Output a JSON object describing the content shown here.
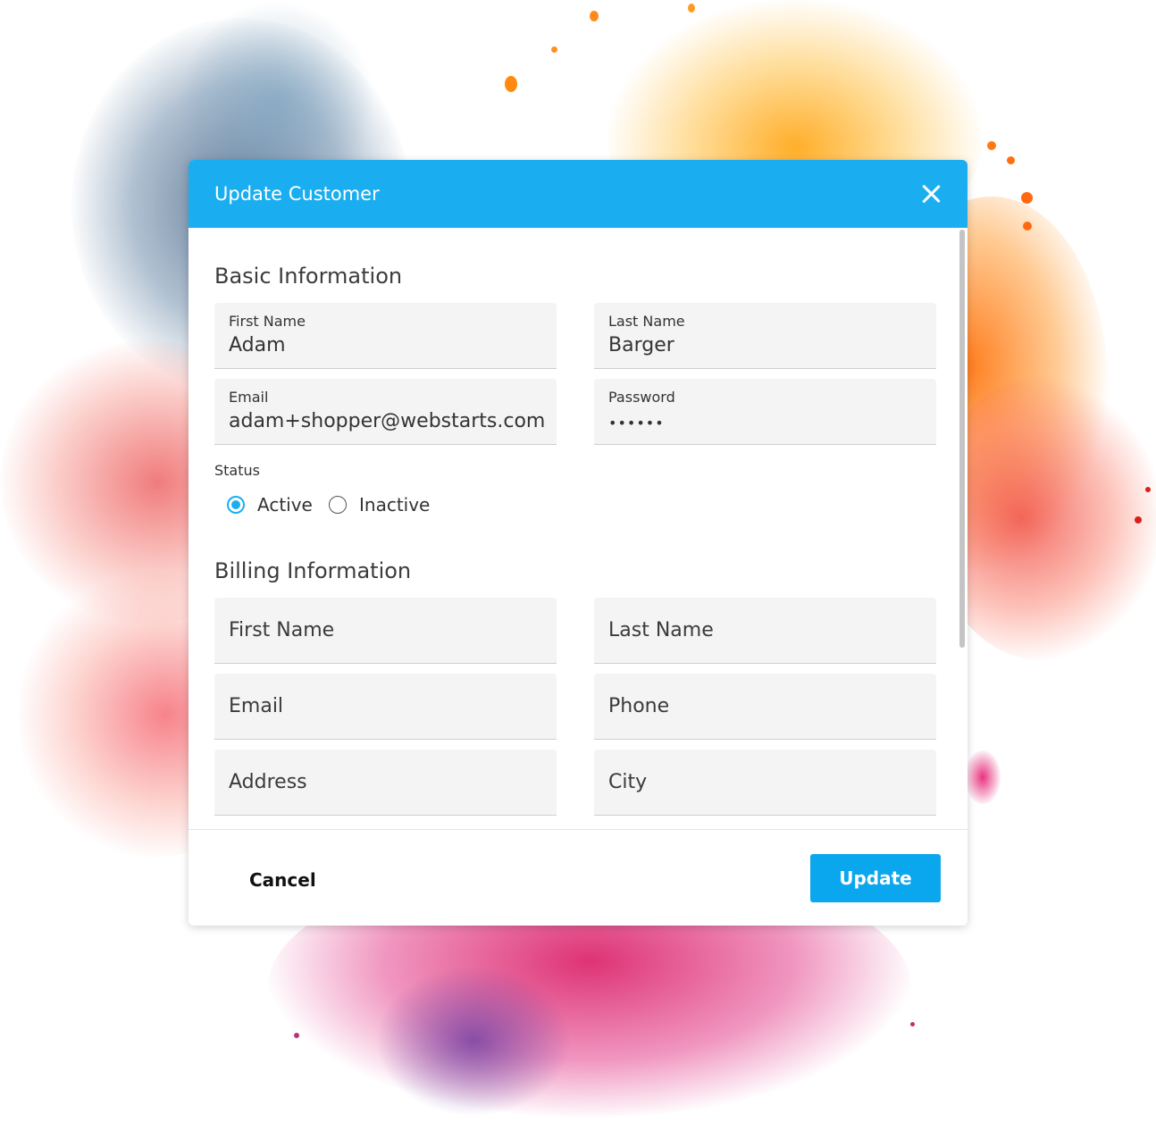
{
  "dialog": {
    "title": "Update Customer",
    "close_icon": "close-icon"
  },
  "basic": {
    "section_title": "Basic Information",
    "first_name": {
      "label": "First Name",
      "value": "Adam"
    },
    "last_name": {
      "label": "Last Name",
      "value": "Barger"
    },
    "email": {
      "label": "Email",
      "value": "adam+shopper@webstarts.com"
    },
    "password": {
      "label": "Password",
      "value": "••••••"
    },
    "status": {
      "label": "Status",
      "options": [
        {
          "label": "Active",
          "selected": true
        },
        {
          "label": "Inactive",
          "selected": false
        }
      ]
    }
  },
  "billing": {
    "section_title": "Billing Information",
    "fields": {
      "first_name": "First Name",
      "last_name": "Last Name",
      "email": "Email",
      "phone": "Phone",
      "address": "Address",
      "city": "City"
    }
  },
  "footer": {
    "cancel_label": "Cancel",
    "update_label": "Update"
  },
  "colors": {
    "header_bg": "#1aaef0",
    "primary_button": "#0aa6ee",
    "field_bg": "#f4f4f4"
  }
}
